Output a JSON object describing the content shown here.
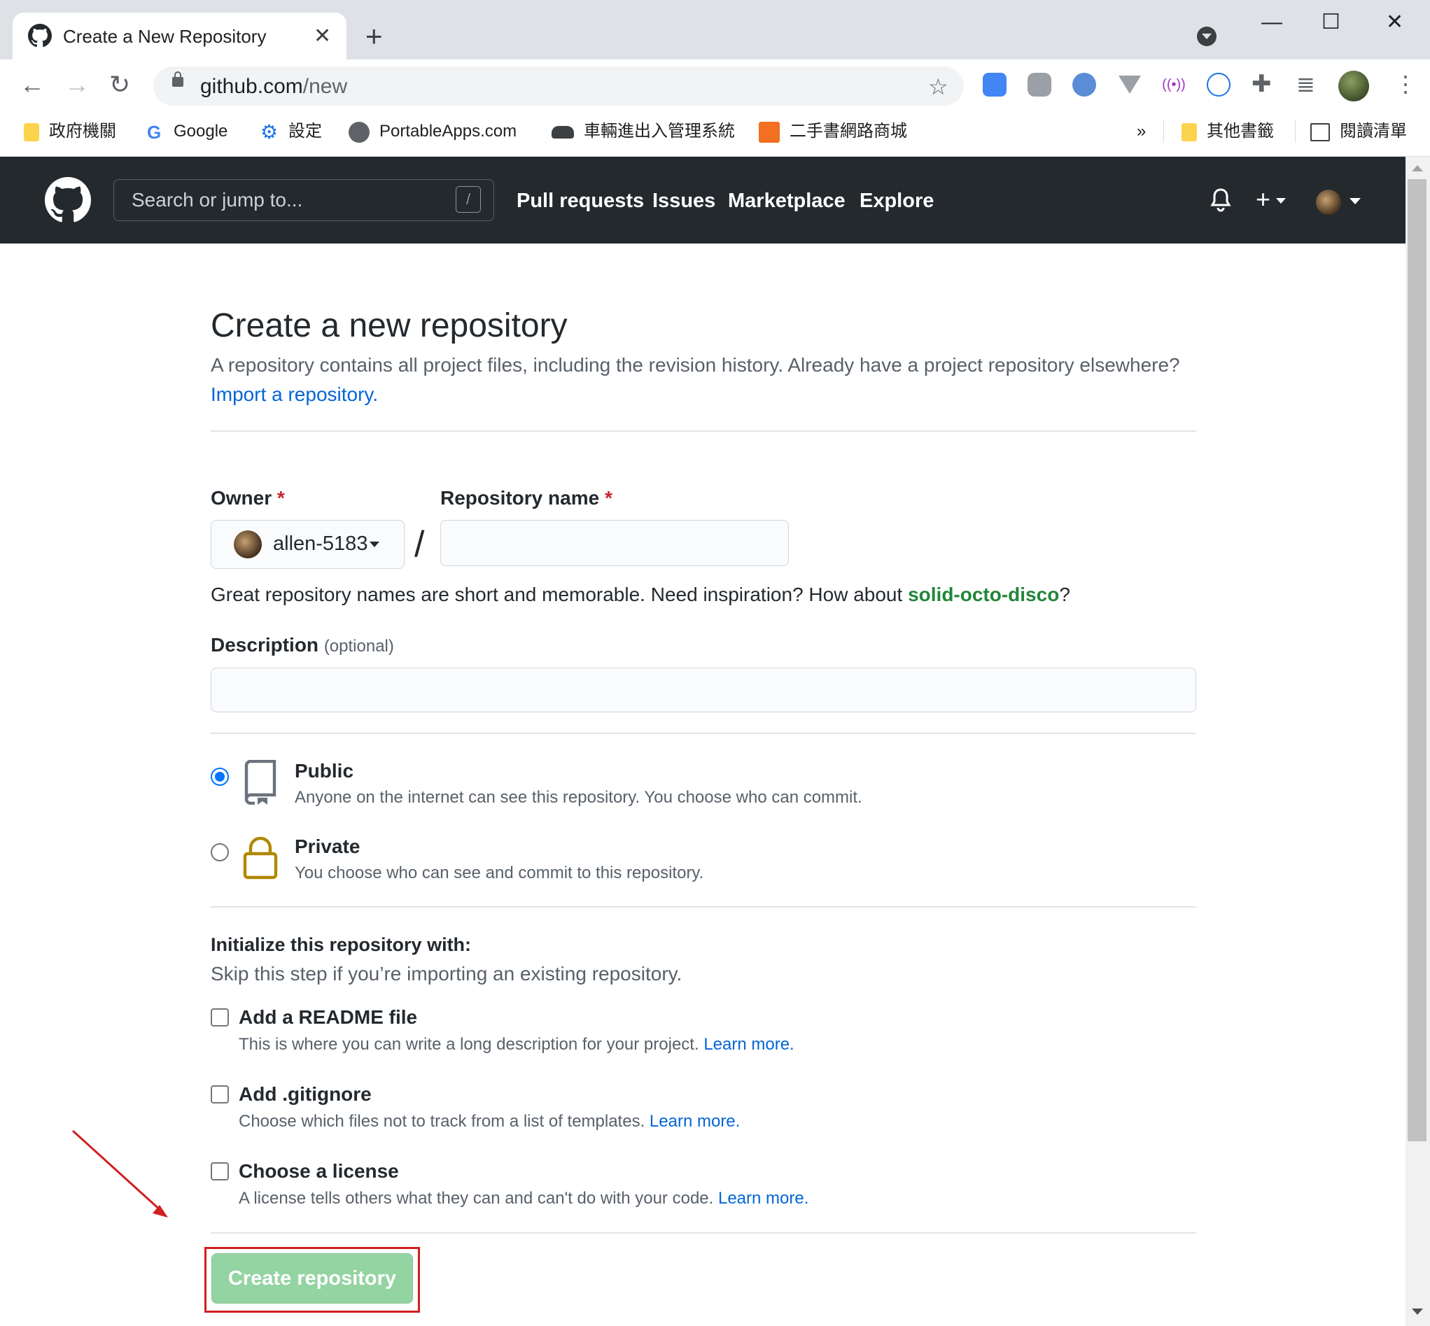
{
  "browser": {
    "tab_title": "Create a New Repository",
    "tab_close": "✕",
    "new_tab": "+",
    "window_controls": {
      "minimize": "—",
      "maximize": "☐",
      "close": "✕"
    },
    "url_host": "github.com",
    "url_path": "/new",
    "bookmarks": [
      {
        "label": "政府機關",
        "icon": "folder-icon"
      },
      {
        "label": "Google",
        "icon": "google-icon"
      },
      {
        "label": "設定",
        "icon": "gear-icon"
      },
      {
        "label": "PortableApps.com",
        "icon": "portableapps-icon"
      },
      {
        "label": "車輛進出入管理系統",
        "icon": "car-icon"
      },
      {
        "label": "二手書網路商城",
        "icon": "bookstore-icon"
      }
    ],
    "bookmarks_overflow": "»",
    "other_bookmarks": "其他書籤",
    "reading_list": "閱讀清單"
  },
  "github_header": {
    "search_placeholder": "Search or jump to...",
    "search_shortcut": "/",
    "nav": [
      "Pull requests",
      "Issues",
      "Marketplace",
      "Explore"
    ],
    "plus_label": "+"
  },
  "page": {
    "title": "Create a new repository",
    "subtitle": "A repository contains all project files, including the revision history. Already have a project repository elsewhere?",
    "import_link": "Import a repository.",
    "owner_label": "Owner",
    "required_mark": "*",
    "owner_value": "allen-5183",
    "separator": "/",
    "repo_name_label": "Repository name",
    "repo_name_value": "",
    "hint_text": "Great repository names are short and memorable. Need inspiration? How about ",
    "hint_suggestion": "solid-octo-disco",
    "hint_end": "?",
    "description_label": "Description",
    "description_optional": "(optional)",
    "description_value": "",
    "visibility": [
      {
        "title": "Public",
        "desc": "Anyone on the internet can see this repository. You choose who can commit.",
        "selected": true
      },
      {
        "title": "Private",
        "desc": "You choose who can see and commit to this repository.",
        "selected": false
      }
    ],
    "init_title": "Initialize this repository with:",
    "init_subtitle": "Skip this step if you’re importing an existing repository.",
    "init_options": [
      {
        "title": "Add a README file",
        "desc": "This is where you can write a long description for your project.",
        "link": "Learn more.",
        "checked": false
      },
      {
        "title": "Add .gitignore",
        "desc": "Choose which files not to track from a list of templates.",
        "link": "Learn more.",
        "checked": false
      },
      {
        "title": "Choose a license",
        "desc": "A license tells others what they can and can't do with your code.",
        "link": "Learn more.",
        "checked": false
      }
    ],
    "create_button": "Create repository"
  },
  "colors": {
    "header_bg": "#24292e",
    "link": "#0366d6",
    "suggestion": "#22863a",
    "create_button_disabled": "#94d3a2",
    "annotation_red": "#d11f1f"
  }
}
